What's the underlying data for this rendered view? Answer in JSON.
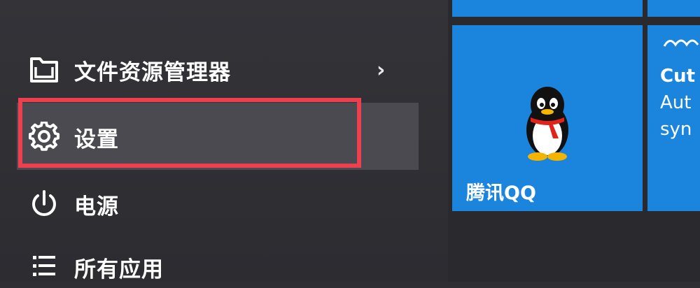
{
  "menu": {
    "file_explorer_label": "文件资源管理器",
    "settings_label": "设置",
    "power_label": "电源",
    "all_apps_label": "所有应用"
  },
  "tiles": {
    "qq_label": "腾讯QQ",
    "news_line1": "Cut",
    "news_line2": "Aut",
    "news_line3": "syn"
  },
  "colors": {
    "tile_blue": "#1b84dc",
    "highlight_red": "#ee3f4e",
    "menu_bg": "#333338"
  },
  "icons": {
    "file_explorer": "folder-icon",
    "settings": "gear-icon",
    "power": "power-icon",
    "all_apps": "list-icon",
    "submenu": "chevron-right-icon",
    "qq": "qq-penguin-icon"
  }
}
